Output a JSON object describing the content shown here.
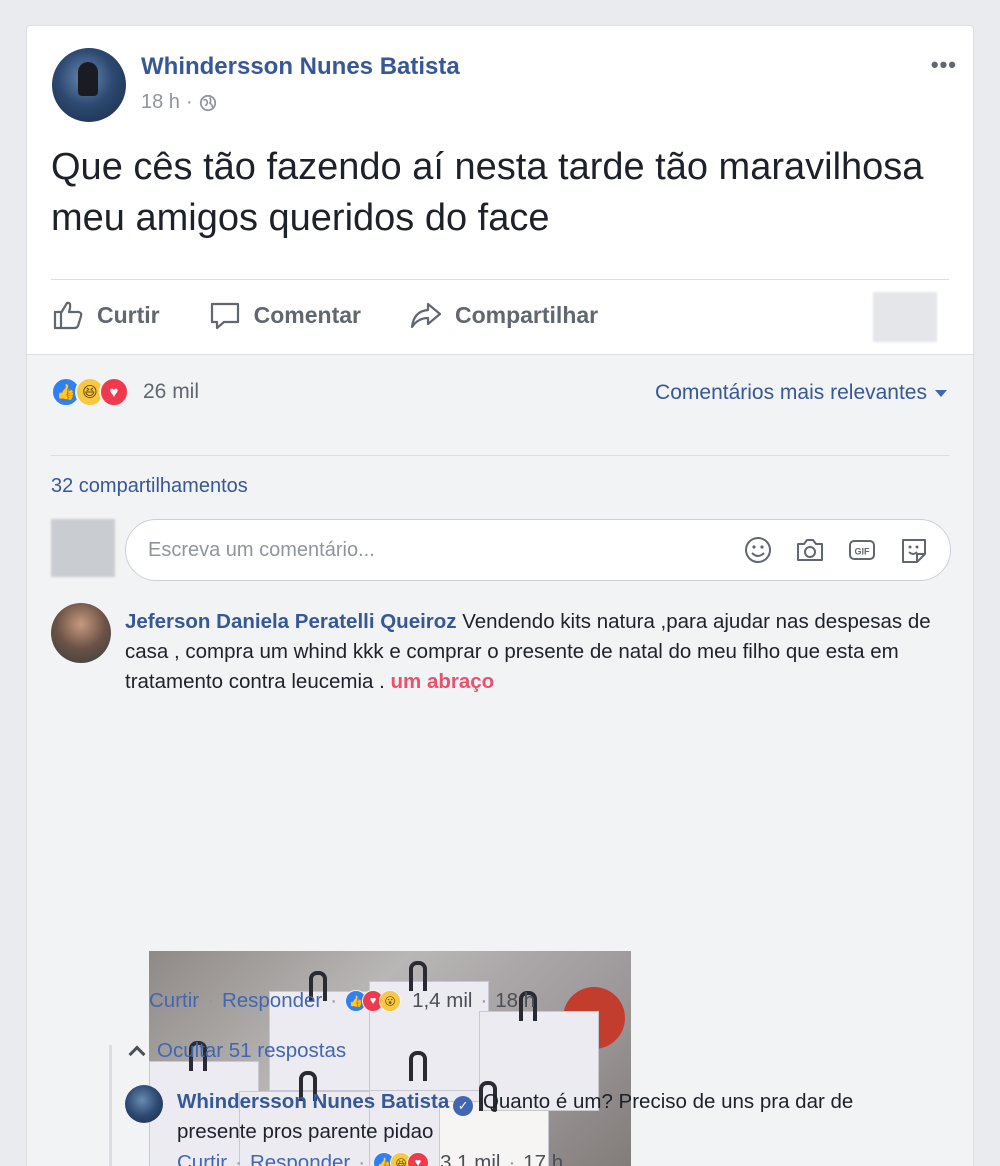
{
  "post": {
    "author": "Whindersson Nunes Batista",
    "time": "18 h",
    "meta_sep": "·",
    "more": "•••",
    "text": "Que cês tão fazendo aí nesta tarde tão maravilhosa meu amigos queridos do face"
  },
  "actions": {
    "like": "Curtir",
    "comment": "Comentar",
    "share": "Compartilhar"
  },
  "stats": {
    "reactions_count": "26 mil",
    "sort_label": "Comentários mais relevantes",
    "shares": "32 compartilhamentos"
  },
  "composer": {
    "placeholder": "Escreva um comentário..."
  },
  "comment": {
    "author": "Jeferson Daniela Peratelli Queiroz",
    "text": " Vendendo kits natura ,para ajudar nas despesas de casa , compra um whind kkk e comprar o presente de natal do meu filho que esta em tratamento contra leucemia . ",
    "more": "um abraço",
    "like": "Curtir",
    "reply": "Responder",
    "reactions": "1,4 mil",
    "time": "18 h",
    "hide_replies": "Ocultar 51 respostas"
  },
  "reply": {
    "author": "Whindersson Nunes Batista",
    "text": " Quanto é um? Preciso de uns pra dar de presente pros parente pidao",
    "like": "Curtir",
    "reply": "Responder",
    "reactions": "3,1 mil",
    "time": "17 h"
  },
  "colors": {
    "link": "#365899",
    "like": "#2e81f4",
    "haha": "#f7c843",
    "love": "#f0394d",
    "more": "#e9516c"
  }
}
